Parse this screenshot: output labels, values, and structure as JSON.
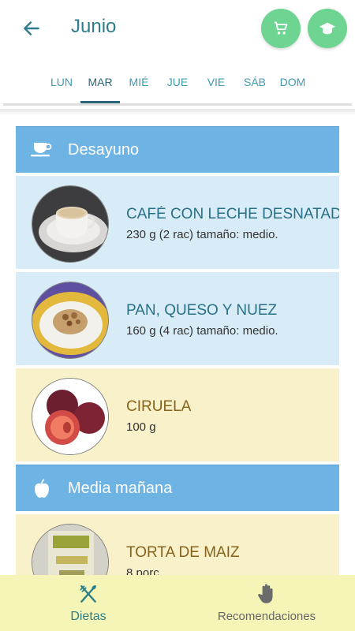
{
  "header": {
    "title": "Junio"
  },
  "tabs": [
    "LUN",
    "MAR",
    "MIÉ",
    "JUE",
    "VIE",
    "SÁB",
    "DOM"
  ],
  "sections": [
    {
      "label": "Desayuno",
      "icon": "cup-icon",
      "items": [
        {
          "name": "CAFÉ CON LECHE DESNATADA",
          "detail": "230 g (2 rac) tamaño: medio.",
          "color": "blue",
          "image": "coffee-photo"
        },
        {
          "name": "PAN, QUESO Y NUEZ",
          "detail": "160 g (4 rac) tamaño: medio.",
          "color": "blue",
          "image": "bread-photo"
        },
        {
          "name": "CIRUELA",
          "detail": "100 g",
          "color": "yellow",
          "image": "plum-photo"
        }
      ]
    },
    {
      "label": "Media mañana",
      "icon": "apple-icon",
      "items": [
        {
          "name": "TORTA DE MAIZ",
          "detail": "8 porc",
          "color": "yellow",
          "image": "corn-cake-photo"
        }
      ]
    }
  ],
  "bottom_nav": {
    "dietas": "Dietas",
    "recomendaciones": "Recomendaciones"
  },
  "colors": {
    "accent": "#6dd492",
    "section_header": "#6db3e4",
    "item_blue": "#d7ecf6",
    "item_yellow": "#f9f1c9",
    "bottom_nav": "#f6f5b8"
  }
}
